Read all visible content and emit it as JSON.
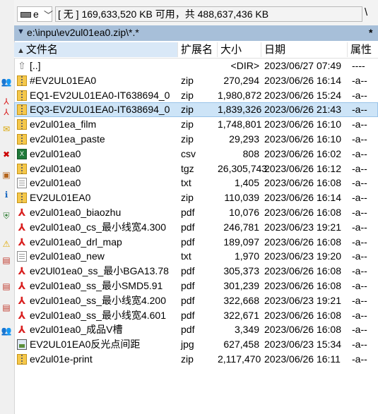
{
  "drive": {
    "letter": "e",
    "info": "[ 无 ]  169,633,520 KB 可用，共 488,637,436 KB",
    "root": "\\"
  },
  "path": {
    "text": "e:\\inpu\\ev2ul01ea0.zip\\*.*",
    "star": "*"
  },
  "columns": {
    "name": "文件名",
    "ext": "扩展名",
    "size": "大小",
    "date": "日期",
    "attr": "属性"
  },
  "files": [
    {
      "name": "[..]",
      "ext": "",
      "size": "<DIR>",
      "date": "2023/06/27 07:49",
      "attr": "----",
      "icon": "up-folder-icon"
    },
    {
      "name": "#EV2UL01EA0",
      "ext": "zip",
      "size": "270,294",
      "date": "2023/06/26 16:14",
      "attr": "-a--",
      "icon": "zip-icon"
    },
    {
      "name": "EQ1-EV2UL01EA0-IT638694_0",
      "ext": "zip",
      "size": "1,980,872",
      "date": "2023/06/26 15:24",
      "attr": "-a--",
      "icon": "zip-icon"
    },
    {
      "name": "EQ3-EV2UL01EA0-IT638694_0",
      "ext": "zip",
      "size": "1,839,326",
      "date": "2023/06/26 21:43",
      "attr": "-a--",
      "icon": "zip-icon"
    },
    {
      "name": "ev2ul01ea_film",
      "ext": "zip",
      "size": "1,748,801",
      "date": "2023/06/26 16:10",
      "attr": "-a--",
      "icon": "zip-icon"
    },
    {
      "name": "ev2ul01ea_paste",
      "ext": "zip",
      "size": "29,293",
      "date": "2023/06/26 16:10",
      "attr": "-a--",
      "icon": "zip-icon"
    },
    {
      "name": "ev2ul01ea0",
      "ext": "csv",
      "size": "808",
      "date": "2023/06/26 16:02",
      "attr": "-a--",
      "icon": "csv-icon"
    },
    {
      "name": "ev2ul01ea0",
      "ext": "tgz",
      "size": "26,305,743",
      "date": "2023/06/26 16:12",
      "attr": "-a--",
      "icon": "zip-icon"
    },
    {
      "name": "ev2ul01ea0",
      "ext": "txt",
      "size": "1,405",
      "date": "2023/06/26 16:08",
      "attr": "-a--",
      "icon": "txt-icon"
    },
    {
      "name": "EV2UL01EA0",
      "ext": "zip",
      "size": "110,039",
      "date": "2023/06/26 16:14",
      "attr": "-a--",
      "icon": "zip-icon"
    },
    {
      "name": "ev2ul01ea0_biaozhu",
      "ext": "pdf",
      "size": "10,076",
      "date": "2023/06/26 16:08",
      "attr": "-a--",
      "icon": "pdf-icon"
    },
    {
      "name": "ev2ul01ea0_cs_最小线宽4.300",
      "ext": "pdf",
      "size": "246,781",
      "date": "2023/06/23 19:21",
      "attr": "-a--",
      "icon": "pdf-icon"
    },
    {
      "name": "ev2ul01ea0_drl_map",
      "ext": "pdf",
      "size": "189,097",
      "date": "2023/06/26 16:08",
      "attr": "-a--",
      "icon": "pdf-icon"
    },
    {
      "name": "ev2ul01ea0_new",
      "ext": "txt",
      "size": "1,970",
      "date": "2023/06/23 19:20",
      "attr": "-a--",
      "icon": "txt-icon"
    },
    {
      "name": "ev2Ul01ea0_ss_最小BGA13.78",
      "ext": "pdf",
      "size": "305,373",
      "date": "2023/06/26 16:08",
      "attr": "-a--",
      "icon": "pdf-icon"
    },
    {
      "name": "ev2ul01ea0_ss_最小SMD5.91",
      "ext": "pdf",
      "size": "301,239",
      "date": "2023/06/26 16:08",
      "attr": "-a--",
      "icon": "pdf-icon"
    },
    {
      "name": "ev2ul01ea0_ss_最小线宽4.200",
      "ext": "pdf",
      "size": "322,668",
      "date": "2023/06/23 19:21",
      "attr": "-a--",
      "icon": "pdf-icon"
    },
    {
      "name": "ev2ul01ea0_ss_最小线宽4.601",
      "ext": "pdf",
      "size": "322,671",
      "date": "2023/06/26 16:08",
      "attr": "-a--",
      "icon": "pdf-icon"
    },
    {
      "name": "ev2ul01ea0_成品V槽",
      "ext": "pdf",
      "size": "3,349",
      "date": "2023/06/26 16:08",
      "attr": "-a--",
      "icon": "pdf-icon"
    },
    {
      "name": "EV2UL01EA0反光点间距",
      "ext": "jpg",
      "size": "627,458",
      "date": "2023/06/23 15:34",
      "attr": "-a--",
      "icon": "jpg-icon"
    },
    {
      "name": "ev2ul01e-print",
      "ext": "zip",
      "size": "2,117,470",
      "date": "2023/06/26 16:11",
      "attr": "-a--",
      "icon": "zip-icon"
    }
  ],
  "selected_index": 3,
  "left_toolbar": [
    {
      "icon": "users-icon",
      "glyph": "👥"
    },
    {
      "icon": "pdf-icon",
      "glyph": "⅄"
    },
    {
      "icon": "pdf-icon",
      "glyph": "⅄"
    },
    {
      "icon": "mail-icon",
      "glyph": "✉"
    },
    {
      "icon": "delete-icon",
      "glyph": "✖"
    },
    {
      "icon": "image-icon",
      "glyph": "▣"
    },
    {
      "icon": "info-icon",
      "glyph": "ℹ"
    },
    {
      "icon": "shield-icon",
      "glyph": "⛨"
    },
    {
      "icon": "warning-icon",
      "glyph": "⚠"
    },
    {
      "icon": "document-icon",
      "glyph": "▤"
    },
    {
      "icon": "document-icon",
      "glyph": "▤"
    },
    {
      "icon": "document-icon",
      "glyph": "▤"
    },
    {
      "icon": "users-icon",
      "glyph": "👥"
    }
  ]
}
